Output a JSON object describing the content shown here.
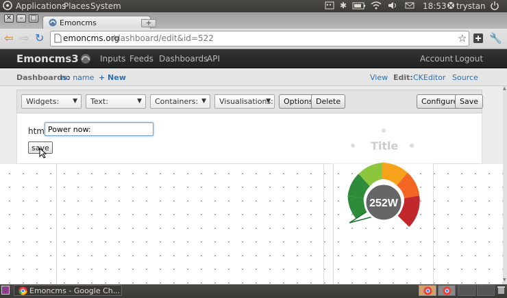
{
  "system_panel": {
    "menus": [
      "Applications",
      "Places",
      "System"
    ],
    "time": "18:53",
    "user": "trystan"
  },
  "browser": {
    "tab_title": "Emoncms",
    "url_domain": "emoncms.org",
    "url_path": "/dashboard/edit&id=522"
  },
  "app": {
    "brand": "Emoncms3",
    "nav": [
      "Inputs",
      "Feeds",
      "Dashboards",
      "API"
    ],
    "account": "Account",
    "logout": "Logout"
  },
  "dashboard_bar": {
    "label": "Dashboards:",
    "dashboard_name": "no name",
    "new_label": "+ New",
    "view": "View",
    "edit_label": "Edit:",
    "ckeditor": "CKEditor",
    "source": "Source"
  },
  "widget_toolbar": {
    "widgets": "Widgets:",
    "text": "Text:",
    "containers": "Containers:",
    "visualisations": "Visualisations:",
    "options": "Options",
    "delete": "Delete",
    "configure": "Configure",
    "save": "Save"
  },
  "html_editor": {
    "label": "html:",
    "value": "Power now:",
    "save": "save"
  },
  "widgets": {
    "title_text": "Title",
    "dial_value": "252W",
    "dial_colors": [
      "#2e8b3a",
      "#8cc63f",
      "#f7a21b",
      "#f26522",
      "#c1272d"
    ]
  },
  "taskbar": {
    "window_title": "Emoncms - Google Ch..."
  }
}
